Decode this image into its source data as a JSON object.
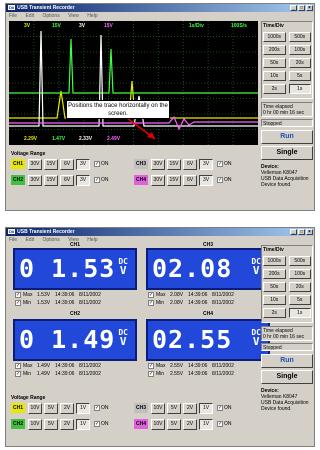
{
  "app": {
    "title": "USB Transient Recorder",
    "icon_text": "Dll",
    "menu": [
      "File",
      "Edit",
      "Options",
      "View",
      "Help"
    ],
    "window_buttons": [
      "_",
      "□",
      "×"
    ]
  },
  "scope": {
    "top_labels": [
      {
        "text": "3V",
        "color": "#e8e800"
      },
      {
        "text": "15V",
        "color": "#40ff40"
      },
      {
        "text": "3V",
        "color": "#ffffff"
      },
      {
        "text": "15V",
        "color": "#ff60ff"
      },
      {
        "text": "1s/Div",
        "color": "#40ff40"
      },
      {
        "text": "100S/s",
        "color": "#40ff40"
      }
    ],
    "bottom_labels": [
      {
        "text": "2.29V",
        "color": "#e8e800"
      },
      {
        "text": "1.47V",
        "color": "#40ff40"
      },
      {
        "text": "2.33V",
        "color": "#ffffff"
      },
      {
        "text": "2.49V",
        "color": "#ff60ff"
      }
    ],
    "callout_text": "Positions the trace horizontally on the screen.",
    "colors": {
      "ch1": "#e8e800",
      "ch2": "#40ff40",
      "ch3": "#ffffff",
      "ch4": "#ff60ff",
      "arrow": "#e00000",
      "grid": "#1a4a1a"
    }
  },
  "time_div": {
    "title": "Time/Div",
    "buttons": [
      "1000s",
      "500s",
      "200s",
      "100s",
      "50s",
      "20s",
      "10s",
      "5s",
      "2s",
      "1s"
    ],
    "selected": "1s"
  },
  "time_elapsed": {
    "label": "Time elapsed",
    "value": "0 hr  00 min  16 sec"
  },
  "time_elapsed2": {
    "label": "Time elapsed",
    "value": "0 hr  00 min  16 sec"
  },
  "status": {
    "text": "Stopped"
  },
  "controls": {
    "run": "Run",
    "single": "Single"
  },
  "device": {
    "title": "Device:",
    "lines": [
      "Velleman  K8047",
      "USB Data Acquisition",
      "Device found."
    ]
  },
  "voltage_range_top": {
    "title": "Voltage Range",
    "ranges": [
      "30V",
      "15V",
      "6V",
      "3V"
    ],
    "on_label": "ON",
    "channels": [
      {
        "name": "CH1",
        "color": "#e8e800",
        "selected": "3V"
      },
      {
        "name": "CH2",
        "color": "#40c040",
        "selected": "3V"
      },
      {
        "name": "CH3",
        "color": "#c0c0c0",
        "selected": "3V"
      },
      {
        "name": "CH4",
        "color": "#e060e0",
        "selected": "3V"
      }
    ]
  },
  "voltage_range_bottom": {
    "title": "Voltage Range",
    "ranges": [
      "10V",
      "5V",
      "2V",
      "1V"
    ],
    "on_label": "ON",
    "channels": [
      {
        "name": "CH1",
        "color": "#e8e800",
        "selected": "1V"
      },
      {
        "name": "CH2",
        "color": "#40c040",
        "selected": "1V"
      },
      {
        "name": "CH3",
        "color": "#c0c0c0",
        "selected": "1V"
      },
      {
        "name": "CH4",
        "color": "#e060e0",
        "selected": "1V"
      }
    ]
  },
  "meters": [
    {
      "name": "CH1",
      "value": "0 1.53",
      "unit_top": "DC",
      "unit_bottom": "V",
      "max": {
        "label": "Max",
        "value": "1.53V",
        "time": "14:39:06",
        "date": "8/11/2002"
      },
      "min": {
        "label": "Min",
        "value": "1.53V",
        "time": "14:39:06",
        "date": "8/11/2002"
      }
    },
    {
      "name": "CH3",
      "value": "02.08",
      "unit_top": "DC",
      "unit_bottom": "V",
      "max": {
        "label": "Max",
        "value": "2.08V",
        "time": "14:39:06",
        "date": "8/11/2002"
      },
      "min": {
        "label": "Min",
        "value": "2.08V",
        "time": "14:39:06",
        "date": "8/11/2002"
      }
    },
    {
      "name": "CH2",
      "value": "0 1.49",
      "unit_top": "DC",
      "unit_bottom": "V",
      "max": {
        "label": "Max",
        "value": "1.49V",
        "time": "14:39:06",
        "date": "8/11/2002"
      },
      "min": {
        "label": "Min",
        "value": "1.49V",
        "time": "14:39:06",
        "date": "8/11/2002"
      }
    },
    {
      "name": "CH4",
      "value": "02.55",
      "unit_top": "DC",
      "unit_bottom": "V",
      "max": {
        "label": "Max",
        "value": "2.55V",
        "time": "14:39:06",
        "date": "8/11/2002"
      },
      "min": {
        "label": "Min",
        "value": "2.55V",
        "time": "14:39:06",
        "date": "8/11/2002"
      }
    }
  ]
}
